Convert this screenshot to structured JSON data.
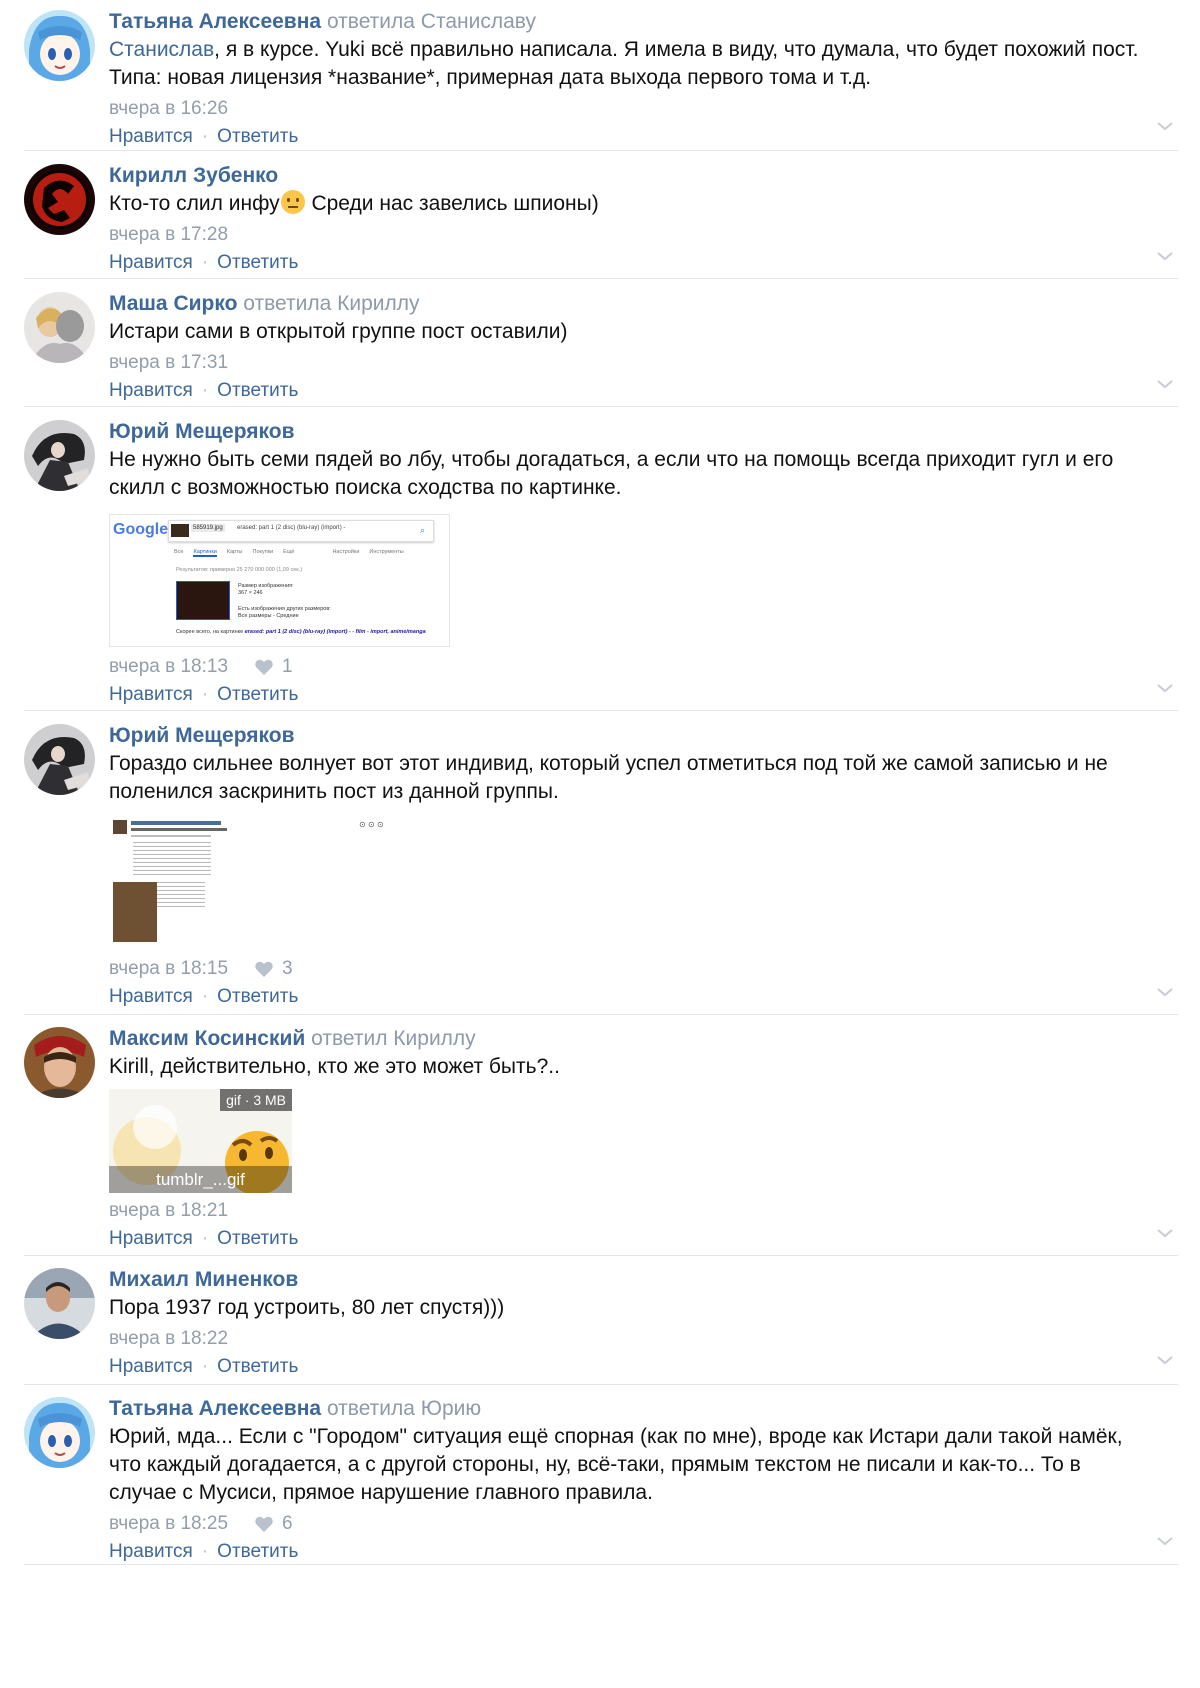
{
  "actions": {
    "like": "Нравится",
    "reply": "Ответить",
    "separator": "·"
  },
  "comments": [
    {
      "author": "Татьяна Алексеевна",
      "action": "ответила Станиславу",
      "mention": "Станислав",
      "text": ", я в курсе. Yuki всё правильно написала. Я имела в виду, что думала, что будет похожий пост. Типа: новая лицензия *название*, примерная дата выхода первого тома и т.д.",
      "time": "вчера в 16:26"
    },
    {
      "author": "Кирилл Зубенко",
      "text_before": "Кто-то слил инфу",
      "text_after": " Среди нас завелись шпионы)",
      "time": "вчера в 17:28"
    },
    {
      "author": "Маша Сирко",
      "action": "ответила Кириллу",
      "text": "Истари сами в открытой группе пост оставили)",
      "time": "вчера в 17:31"
    },
    {
      "author": "Юрий Мещеряков",
      "text": "Не нужно быть семи пядей во лбу, чтобы догадаться, а если что на помощь всегда приходит гугл и его скилл с возможностью поиска сходства по картинке.",
      "time": "вчера в 18:13",
      "likes": "1",
      "attachment": {
        "logo": "Google",
        "file": "585919.jpg",
        "query": "erased: part 1 (2 disc) (blu-ray) (import) -",
        "tabs": [
          "Все",
          "Картинки",
          "Карты",
          "Покупки",
          "Ещё",
          "Настройки",
          "Инструменты"
        ],
        "results": "Результатов: примерно 25 270 000 000 (1,09 сек.)",
        "size_label": "Размер изображения:",
        "size_value": "367 × 246",
        "other_sizes": "Есть изображения других размеров:",
        "other_sizes_links": "Все размеры - Средние",
        "best_guess_label": "Скорее всего, на картинке",
        "best_guess": "erased: part 1 (2 disc) (blu-ray) (import) - - film - import, anime/manga"
      }
    },
    {
      "author": "Юрий Мещеряков",
      "text": "Гораздо сильнее волнует вот этот индивид, который успел отметиться под той же самой записью и не поленился заскринить пост из данной группы.",
      "time": "вчера в 18:15",
      "likes": "3"
    },
    {
      "author": "Максим Косинский",
      "action": "ответил Кириллу",
      "text": "Kirill, действительно, кто же это может быть?..",
      "time": "вчера в 18:21",
      "gif": {
        "badge": "gif · 3 MB",
        "name": "tumblr_...gif"
      }
    },
    {
      "author": "Михаил Миненков",
      "text": "Пора 1937 год устроить, 80 лет спустя)))",
      "time": "вчера в 18:22"
    },
    {
      "author": "Татьяна Алексеевна",
      "action": "ответила Юрию",
      "text": "Юрий, мда... Если с \"Городом\" ситуация ещё спорная (как по мне), вроде как Истари дали такой намёк, что каждый догадается, а с другой стороны, ну, всё-таки, прямым текстом не писали и как-то... То в случае с Мусиси, прямое нарушение главного правила.",
      "time": "вчера в 18:25",
      "likes": "6"
    }
  ],
  "colors": {
    "link": "#3d6898",
    "meta": "#939ea9",
    "divider": "#e2e6ea"
  }
}
